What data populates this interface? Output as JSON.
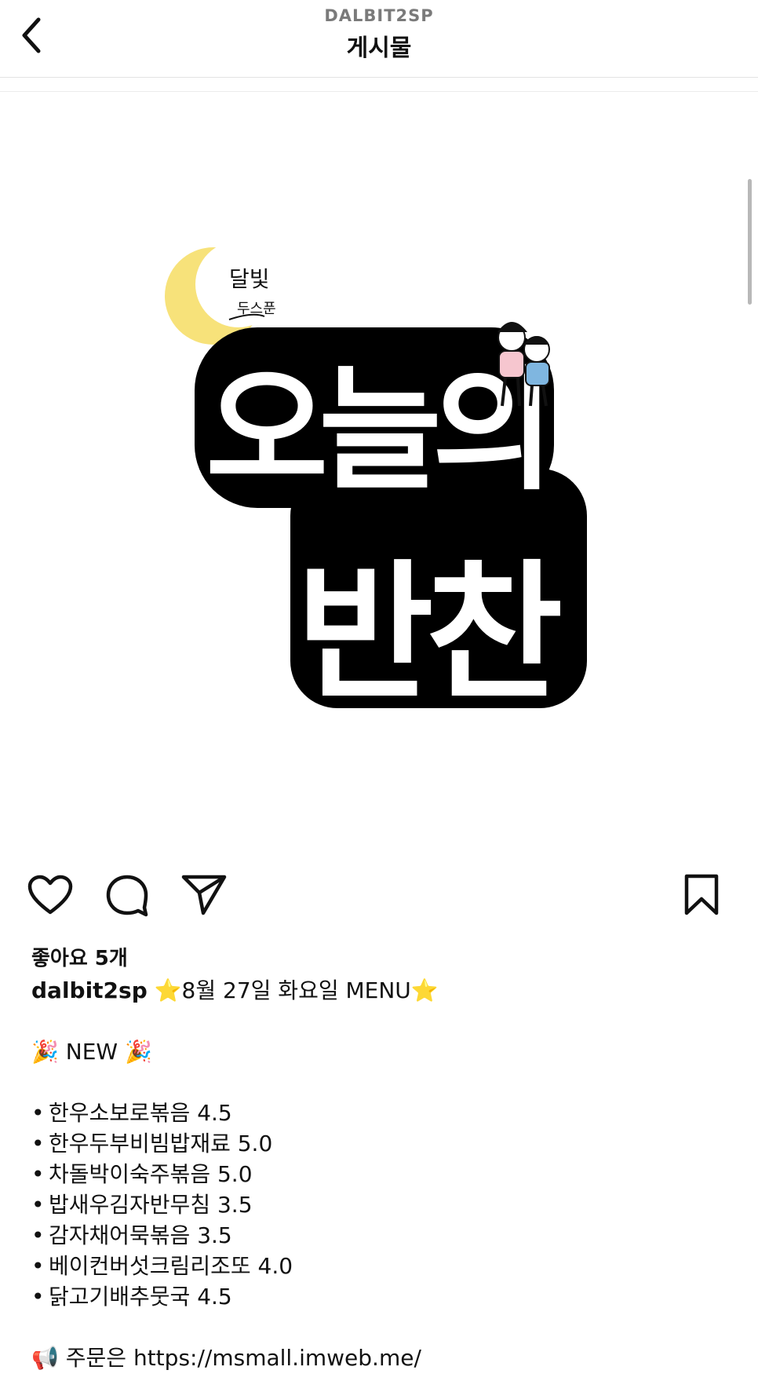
{
  "header": {
    "username": "DALBIT2SP",
    "title": "게시물"
  },
  "post_image": {
    "logo_top_small": "달빛",
    "logo_sub_small": "두스푼",
    "logo_line1": "오늘의",
    "logo_line2": "반찬",
    "colors": {
      "moon": "#f7e27a",
      "outline": "#000000",
      "fill": "#ffffff"
    }
  },
  "actions": {
    "like_icon": "heart-icon",
    "comment_icon": "comment-icon",
    "share_icon": "paper-plane-icon",
    "save_icon": "bookmark-icon"
  },
  "likes_text": "좋아요 5개",
  "caption": {
    "username": "dalbit2sp",
    "headline_star_left": "⭐",
    "headline": "8월 27일 화요일 MENU",
    "headline_star_right": "⭐",
    "new_emoji_left": "🎉",
    "new_label": "NEW",
    "new_emoji_right": "🎉",
    "bullet": "•",
    "menu_items": [
      "한우소보로볶음 4.5",
      "한우두부비빔밥재료 5.0",
      "차돌박이숙주볶음 5.0",
      "밥새우김자반무침 3.5",
      "감자채어묵볶음 3.5",
      "베이컨버섯크림리조또 4.0",
      "닭고기배추뭇국 4.5"
    ],
    "order_emoji": "📢",
    "order_text": "주문은 https://msmall.imweb.me/"
  }
}
